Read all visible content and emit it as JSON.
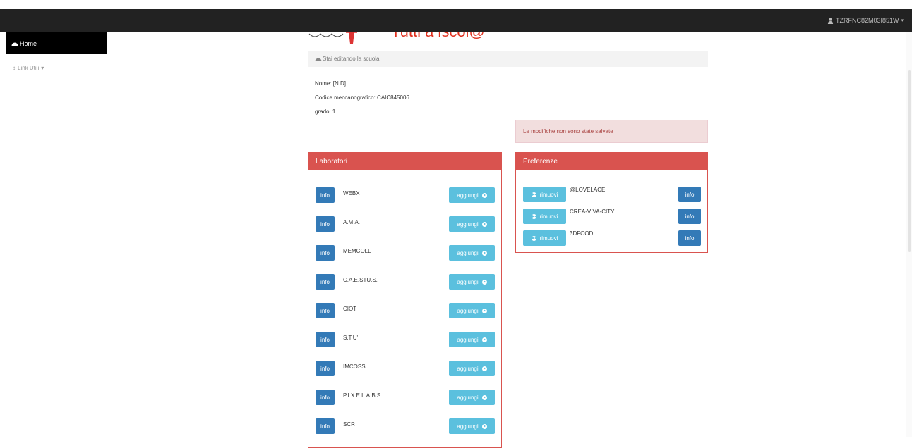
{
  "navbar": {
    "user": "TZRFNC82M03I851W"
  },
  "sidebar": {
    "home": "Home",
    "links": "Link Utili"
  },
  "header": {
    "title": "Tutti a iscol@"
  },
  "editing": {
    "label": "Stai editando la scuola:"
  },
  "school": {
    "name": "Nome: [N.D]",
    "code": "Codice meccanografico: CAIC845006",
    "grade": "grado: 1"
  },
  "alert": "Le modifiche non sono state salvate",
  "laboratori": {
    "title": "Laboratori",
    "info_label": "info",
    "add_label": "aggiungi",
    "items": [
      "WEBX",
      "A.M.A.",
      "MEMCOLL",
      "C.A.E.STU.S.",
      "CIOT",
      "S.T.U'",
      "IMCOSS",
      "P.I.X.E.L.A.B.S.",
      "SCR"
    ]
  },
  "preferenze": {
    "title": "Preferenze",
    "remove_label": "rimuovi",
    "info_label": "info",
    "items": [
      "@LOVELACE",
      "CREA-VIVA-CITY",
      "3DFOOD"
    ]
  }
}
